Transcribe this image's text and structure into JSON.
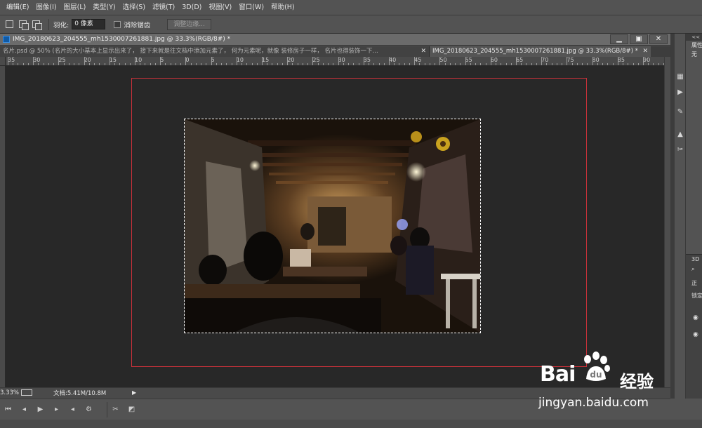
{
  "menu": [
    "编辑(E)",
    "图像(I)",
    "图层(L)",
    "类型(Y)",
    "选择(S)",
    "滤镜(T)",
    "3D(D)",
    "视图(V)",
    "窗口(W)",
    "帮助(H)"
  ],
  "options": {
    "feather_label": "羽化:",
    "feather_value": "0 像素",
    "antialias_label": "消除锯齿",
    "refine_edge_button": "调整边缘..."
  },
  "document": {
    "title": "IMG_20180623_204555_mh1530007261881.jpg @ 33.3%(RGB/8#) *",
    "tabs": [
      {
        "label": "名片.psd @ 50% (名片的大小基本上显示出来了， 接下来就是往文档中添加元素了， 何为元素呢，就像 装修房子一样， 名片也得装饰一下...",
        "active": false
      },
      {
        "label": "IMG_20180623_204555_mh1530007261881.jpg @ 33.3%(RGB/8#) *",
        "active": true
      }
    ],
    "ruler_labels": [
      "35",
      "30",
      "25",
      "20",
      "15",
      "10",
      "5",
      "0",
      "5",
      "10",
      "15",
      "20",
      "25",
      "30",
      "35",
      "40",
      "45",
      "50",
      "55",
      "60",
      "65",
      "70",
      "75",
      "80",
      "85",
      "90"
    ]
  },
  "status": {
    "zoom": "3.33%",
    "doc_size": "文档:5.41M/10.8M"
  },
  "right_panel": {
    "head": "<<",
    "tab1": "属性",
    "item1": "无",
    "section2_label": "3D",
    "item2": "正",
    "item3": "锁定"
  },
  "watermark": {
    "logo": "Bai",
    "logo_du": "du",
    "cn": "经验",
    "url": "jingyan.baidu.com"
  },
  "colors": {
    "accent_artboard": "#c8313a",
    "workspace_bg": "#282828",
    "ui_bg": "#535353"
  }
}
